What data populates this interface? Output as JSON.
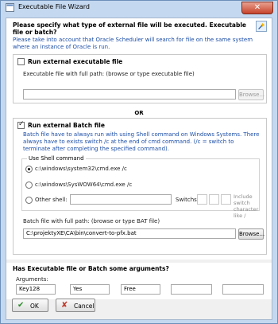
{
  "window": {
    "title": "Executable File Wizard",
    "close_glyph": "✕"
  },
  "header": {
    "heading": "Please specify what type of external file will be executed. Executable file or batch?",
    "note": "Please take into account that Oracle Scheduler will search for file on the same system where an instance of Oracle is run.",
    "wizard_icon": "wizard-icon"
  },
  "exe_section": {
    "checkbox_label": "Run external executable file",
    "checked": false,
    "field_label": "Executable file with full path: (browse or type executable file)",
    "path_value": "",
    "browse_label": "Browse..."
  },
  "or_label": "OR",
  "batch_section": {
    "checkbox_label": "Run external Batch file",
    "checked": true,
    "note": "Batch file have to always run with using Shell command on Windows Systems.  There always have to exists switch /c at the end of cmd command. (/c = switch to terminate after completing the specified command).",
    "shell_group_title": "Use Shell command",
    "shell_options": [
      {
        "label": "c:\\windows\\system32\\cmd.exe /c",
        "selected": true
      },
      {
        "label": "c:\\windows\\SysWOW64\\cmd.exe /c",
        "selected": false
      },
      {
        "label": "Other shell:",
        "selected": false
      }
    ],
    "other_shell_value": "",
    "switches_label": "Switchs:",
    "switch_note": "Include switch character like /",
    "field_label": "Batch file with full path: (browse or type BAT file)",
    "path_value": "C:\\projektyXE\\CA\\bin\\convert-to-pfx.bat",
    "browse_label": "Browse..."
  },
  "arguments_section": {
    "heading": "Has Executable file or Batch some arguments?",
    "label": "Arguments:",
    "values": [
      "Key128",
      "Yes",
      "Free",
      "",
      "",
      ""
    ]
  },
  "footer": {
    "ok_label": "OK",
    "cancel_label": "Cancel",
    "colors": {
      "ok_check": "#2e8b2e",
      "cancel_x": "#c0392b"
    }
  }
}
